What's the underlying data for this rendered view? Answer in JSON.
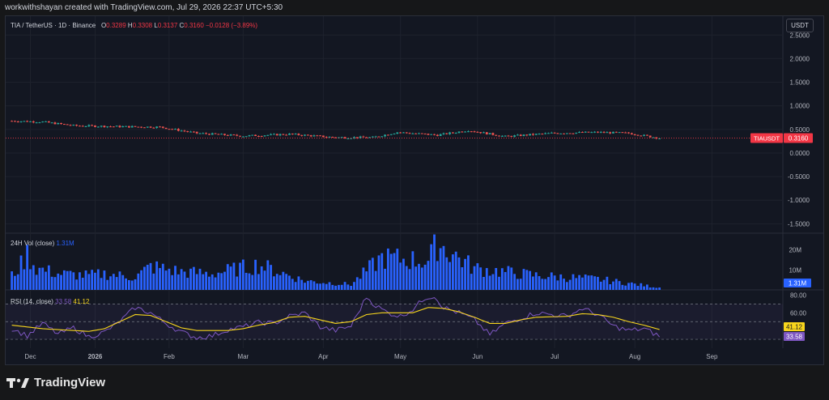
{
  "caption": "workwithshayan created with TradingView.com, Jul 29, 2026 22:37 UTC+5:30",
  "legend": {
    "symbol": "TIA / TetherUS · 1D · Binance",
    "o_label": "O",
    "o_value": "0.3289",
    "h_label": "H",
    "h_value": "0.3308",
    "l_label": "L",
    "l_value": "0.3137",
    "c_label": "C",
    "c_value": "0.3160",
    "change": "−0.0128 (−3.89%)"
  },
  "currency_button": "USDT",
  "price_tag": {
    "symbol": "TIAUSDT",
    "value": "0.3160"
  },
  "volume": {
    "label": "24H Vol (close)",
    "value": "1.31M",
    "tag": "1.31M"
  },
  "rsi": {
    "label": "RSI (14, close)",
    "value1": "33.58",
    "value2": "41.12",
    "tag1": "41.12",
    "tag2": "33.58"
  },
  "brand": "TradingView",
  "colors": {
    "up": "#26a69a",
    "down": "#ef5350",
    "volume": "#2962ff",
    "rsi": "#7e57c2",
    "rsi_ma": "#f7d51d",
    "price_tag": "#f23645"
  },
  "chart_data": [
    {
      "type": "candlestick",
      "title": "TIA / TetherUS · 1D · Binance",
      "y_ticks": [
        "2.5000",
        "2.0000",
        "1.5000",
        "1.0000",
        "0.5000",
        "0.0000",
        "-0.5000",
        "-1.0000",
        "-1.5000"
      ],
      "y_tick_values": [
        2.5,
        2.0,
        1.5,
        1.0,
        0.5,
        0.0,
        -0.5,
        -1.0,
        -1.5
      ],
      "ylim": [
        -1.7,
        2.9
      ],
      "x_ticks": [
        "Dec",
        "2026",
        "Feb",
        "Mar",
        "Apr",
        "May",
        "Jun",
        "Jul",
        "Aug",
        "Sep"
      ],
      "x_tick_index": [
        6,
        27,
        51,
        75,
        101,
        126,
        151,
        176,
        202,
        227
      ],
      "x_range": [
        -2,
        250
      ],
      "close_series_approx": [
        {
          "x": 0,
          "y": 0.68
        },
        {
          "x": 10,
          "y": 0.66
        },
        {
          "x": 20,
          "y": 0.58
        },
        {
          "x": 35,
          "y": 0.56
        },
        {
          "x": 48,
          "y": 0.55
        },
        {
          "x": 60,
          "y": 0.42
        },
        {
          "x": 75,
          "y": 0.36
        },
        {
          "x": 90,
          "y": 0.4
        },
        {
          "x": 105,
          "y": 0.33
        },
        {
          "x": 117,
          "y": 0.33
        },
        {
          "x": 125,
          "y": 0.44
        },
        {
          "x": 138,
          "y": 0.38
        },
        {
          "x": 148,
          "y": 0.48
        },
        {
          "x": 160,
          "y": 0.35
        },
        {
          "x": 175,
          "y": 0.42
        },
        {
          "x": 190,
          "y": 0.44
        },
        {
          "x": 200,
          "y": 0.42
        },
        {
          "x": 210,
          "y": 0.316
        }
      ],
      "last_price": 0.316
    },
    {
      "type": "bar",
      "title": "24H Vol (close)",
      "y_ticks": [
        "20M",
        "10M"
      ],
      "y_tick_values": [
        20,
        10
      ],
      "ylim": [
        0,
        28
      ],
      "unit": "M",
      "values_approx": [
        {
          "x": 0,
          "y": 8
        },
        {
          "x": 3,
          "y": 14
        },
        {
          "x": 5,
          "y": 20
        },
        {
          "x": 8,
          "y": 12
        },
        {
          "x": 15,
          "y": 9
        },
        {
          "x": 25,
          "y": 8
        },
        {
          "x": 30,
          "y": 9
        },
        {
          "x": 40,
          "y": 7
        },
        {
          "x": 45,
          "y": 13
        },
        {
          "x": 55,
          "y": 10
        },
        {
          "x": 65,
          "y": 9
        },
        {
          "x": 80,
          "y": 14
        },
        {
          "x": 95,
          "y": 5
        },
        {
          "x": 110,
          "y": 3
        },
        {
          "x": 120,
          "y": 18
        },
        {
          "x": 135,
          "y": 16
        },
        {
          "x": 138,
          "y": 26
        },
        {
          "x": 150,
          "y": 12
        },
        {
          "x": 170,
          "y": 8
        },
        {
          "x": 190,
          "y": 6
        },
        {
          "x": 210,
          "y": 1.31
        }
      ]
    },
    {
      "type": "line",
      "title": "RSI (14, close)",
      "y_ticks": [
        "80.00",
        "60.00"
      ],
      "y_tick_values": [
        80,
        60
      ],
      "ylim": [
        20,
        85
      ],
      "series": [
        {
          "values_approx": [
            {
              "x": 0,
              "y": 42
            },
            {
              "x": 5,
              "y": 34
            },
            {
              "x": 10,
              "y": 48
            },
            {
              "x": 15,
              "y": 36
            },
            {
              "x": 20,
              "y": 43
            },
            {
              "x": 25,
              "y": 33
            },
            {
              "x": 30,
              "y": 38
            },
            {
              "x": 35,
              "y": 50
            },
            {
              "x": 40,
              "y": 66
            },
            {
              "x": 45,
              "y": 60
            },
            {
              "x": 50,
              "y": 48
            },
            {
              "x": 55,
              "y": 38
            },
            {
              "x": 60,
              "y": 32
            },
            {
              "x": 65,
              "y": 34
            },
            {
              "x": 70,
              "y": 41
            },
            {
              "x": 75,
              "y": 44
            },
            {
              "x": 80,
              "y": 49
            },
            {
              "x": 85,
              "y": 48
            },
            {
              "x": 90,
              "y": 56
            },
            {
              "x": 95,
              "y": 60
            },
            {
              "x": 100,
              "y": 44
            },
            {
              "x": 105,
              "y": 40
            },
            {
              "x": 110,
              "y": 45
            },
            {
              "x": 115,
              "y": 78
            },
            {
              "x": 118,
              "y": 68
            },
            {
              "x": 122,
              "y": 60
            },
            {
              "x": 126,
              "y": 56
            },
            {
              "x": 130,
              "y": 64
            },
            {
              "x": 134,
              "y": 77
            },
            {
              "x": 137,
              "y": 79
            },
            {
              "x": 140,
              "y": 66
            },
            {
              "x": 145,
              "y": 60
            },
            {
              "x": 150,
              "y": 52
            },
            {
              "x": 155,
              "y": 35
            },
            {
              "x": 160,
              "y": 48
            },
            {
              "x": 165,
              "y": 54
            },
            {
              "x": 170,
              "y": 60
            },
            {
              "x": 175,
              "y": 58
            },
            {
              "x": 180,
              "y": 56
            },
            {
              "x": 185,
              "y": 65
            },
            {
              "x": 190,
              "y": 58
            },
            {
              "x": 195,
              "y": 45
            },
            {
              "x": 200,
              "y": 40
            },
            {
              "x": 205,
              "y": 42
            },
            {
              "x": 210,
              "y": 33.58
            }
          ]
        },
        {
          "values_approx": [
            {
              "x": 0,
              "y": 46
            },
            {
              "x": 10,
              "y": 42
            },
            {
              "x": 20,
              "y": 40
            },
            {
              "x": 25,
              "y": 39
            },
            {
              "x": 30,
              "y": 42
            },
            {
              "x": 35,
              "y": 50
            },
            {
              "x": 40,
              "y": 58
            },
            {
              "x": 45,
              "y": 57
            },
            {
              "x": 50,
              "y": 50
            },
            {
              "x": 55,
              "y": 43
            },
            {
              "x": 60,
              "y": 40
            },
            {
              "x": 70,
              "y": 40
            },
            {
              "x": 75,
              "y": 42
            },
            {
              "x": 80,
              "y": 46
            },
            {
              "x": 85,
              "y": 49
            },
            {
              "x": 90,
              "y": 55
            },
            {
              "x": 95,
              "y": 56
            },
            {
              "x": 100,
              "y": 52
            },
            {
              "x": 105,
              "y": 48
            },
            {
              "x": 110,
              "y": 50
            },
            {
              "x": 115,
              "y": 58
            },
            {
              "x": 120,
              "y": 60
            },
            {
              "x": 125,
              "y": 60
            },
            {
              "x": 130,
              "y": 60
            },
            {
              "x": 135,
              "y": 66
            },
            {
              "x": 140,
              "y": 65
            },
            {
              "x": 145,
              "y": 61
            },
            {
              "x": 150,
              "y": 55
            },
            {
              "x": 155,
              "y": 48
            },
            {
              "x": 160,
              "y": 48
            },
            {
              "x": 165,
              "y": 52
            },
            {
              "x": 170,
              "y": 55
            },
            {
              "x": 180,
              "y": 56
            },
            {
              "x": 185,
              "y": 59
            },
            {
              "x": 190,
              "y": 58
            },
            {
              "x": 195,
              "y": 55
            },
            {
              "x": 200,
              "y": 50
            },
            {
              "x": 205,
              "y": 46
            },
            {
              "x": 210,
              "y": 41.12
            }
          ]
        }
      ],
      "reference_lines": [
        70,
        50,
        30
      ]
    }
  ]
}
